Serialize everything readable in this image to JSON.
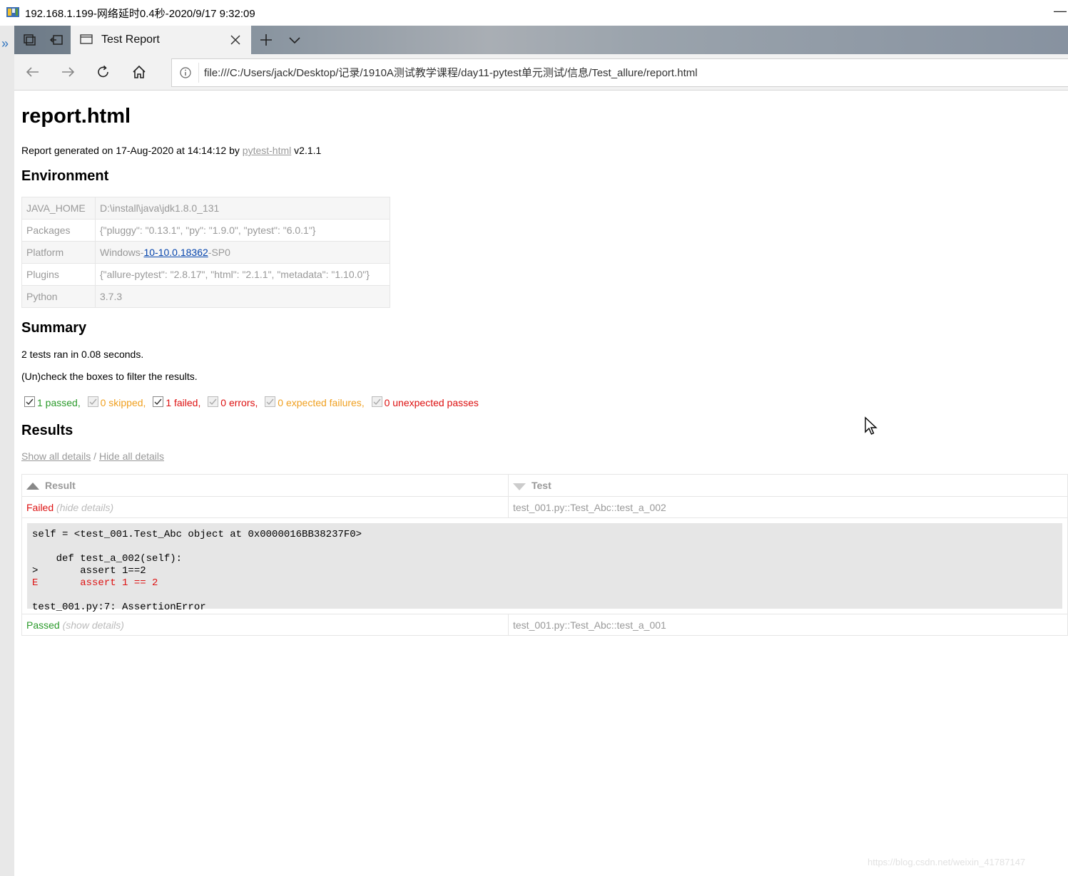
{
  "window": {
    "title": "192.168.1.199-网络延时0.4秒-2020/9/17 9:32:09",
    "minimize_glyph": "—"
  },
  "sidebar": {
    "expand_glyph": "»"
  },
  "browser": {
    "tab": {
      "label": "Test Report"
    },
    "address": {
      "url": "file:///C:/Users/jack/Desktop/记录/1910A测试教学课程/day11-pytest单元测试/信息/Test_allure/report.html"
    }
  },
  "report": {
    "title": "report.html",
    "generated": {
      "prefix": "Report generated on 17-Aug-2020 at 14:14:12 by ",
      "link": "pytest-html",
      "suffix": " v2.1.1"
    },
    "environment": {
      "heading": "Environment",
      "rows": [
        {
          "key": "JAVA_HOME",
          "value": "D:\\install\\java\\jdk1.8.0_131"
        },
        {
          "key": "Packages",
          "value": "{\"pluggy\": \"0.13.1\", \"py\": \"1.9.0\", \"pytest\": \"6.0.1\"}"
        },
        {
          "key": "Platform",
          "value_prefix": "Windows-",
          "value_link": "10-10.0.18362",
          "value_suffix": "-SP0"
        },
        {
          "key": "Plugins",
          "value": "{\"allure-pytest\": \"2.8.17\", \"html\": \"2.1.1\", \"metadata\": \"1.10.0\"}"
        },
        {
          "key": "Python",
          "value": "3.7.3"
        }
      ]
    },
    "summary": {
      "heading": "Summary",
      "ran": "2 tests ran in 0.08 seconds.",
      "hint": "(Un)check the boxes to filter the results.",
      "filters": [
        {
          "label": "1 passed",
          "sep": ",",
          "color": "#2a9a2a",
          "checked": true,
          "enabled": true
        },
        {
          "label": "0 skipped",
          "sep": ",",
          "color": "#f0a020",
          "checked": true,
          "enabled": false
        },
        {
          "label": "1 failed",
          "sep": ",",
          "color": "#d11111",
          "checked": true,
          "enabled": true
        },
        {
          "label": "0 errors",
          "sep": ",",
          "color": "#d11111",
          "checked": true,
          "enabled": false
        },
        {
          "label": "0 expected failures",
          "sep": ",",
          "color": "#f0a020",
          "checked": true,
          "enabled": false
        },
        {
          "label": "0 unexpected passes",
          "sep": "",
          "color": "#d11111",
          "checked": true,
          "enabled": false
        }
      ]
    },
    "results": {
      "heading": "Results",
      "show_all": "Show all details",
      "divider": " / ",
      "hide_all": "Hide all details",
      "columns": {
        "result": "Result",
        "test": "Test"
      },
      "rows": [
        {
          "status": "Failed",
          "toggle": "(hide details)",
          "test": "test_001.py::Test_Abc::test_a_002",
          "log": {
            "line1": "self = <test_001.Test_Abc object at 0x0000016BB38237F0>",
            "line2": "    def test_a_002(self):",
            "line3": ">       assert 1==2",
            "line4": "E       assert 1 == 2",
            "line5": "test_001.py:7: AssertionError"
          }
        },
        {
          "status": "Passed",
          "toggle": "(show details)",
          "test": "test_001.py::Test_Abc::test_a_001"
        }
      ]
    }
  },
  "watermark": "https://blog.csdn.net/weixin_41787147"
}
